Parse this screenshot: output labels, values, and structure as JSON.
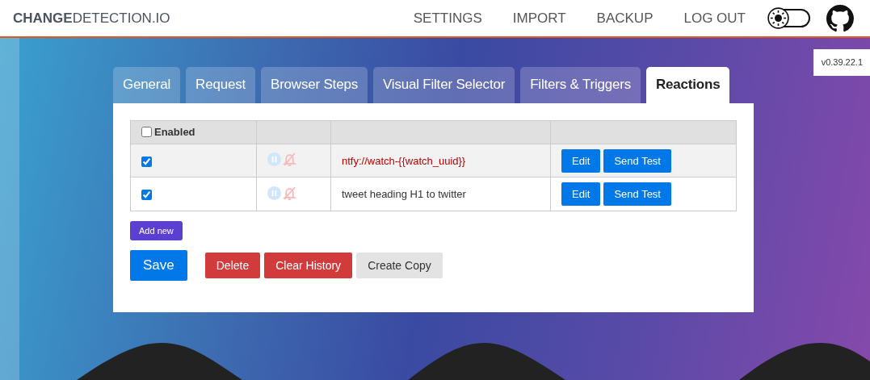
{
  "header": {
    "logo": "**CHANGE**DETECTION.IO",
    "nav": [
      "SETTINGS",
      "IMPORT",
      "BACKUP",
      "LOG OUT"
    ],
    "dark_mode": false
  },
  "version": "v0.39.22.1",
  "tabs": [
    {
      "label": "General",
      "selected": false
    },
    {
      "label": "Request",
      "selected": false
    },
    {
      "label": "Browser Steps",
      "selected": false
    },
    {
      "label": "Visual Filter Selector",
      "selected": false
    },
    {
      "label": "Filters & Triggers",
      "selected": false
    },
    {
      "label": "Reactions",
      "selected": true
    }
  ],
  "table": {
    "header_label": "Enabled",
    "header_checked": false,
    "rows": [
      {
        "checked": true,
        "text": "ntfy://watch-{{watch_uuid}}",
        "error": true,
        "buttons": [
          "Edit",
          "Send Test"
        ]
      },
      {
        "checked": true,
        "text": "tweet heading H1 to twitter",
        "error": false,
        "buttons": [
          "Edit",
          "Send Test"
        ]
      }
    ]
  },
  "add_button": "Add new",
  "actions": [
    {
      "label": "Save",
      "kind": "primary"
    },
    {
      "label": "Delete",
      "kind": "danger"
    },
    {
      "label": "Clear History",
      "kind": "danger"
    },
    {
      "label": "Create Copy",
      "kind": "neutral"
    }
  ]
}
